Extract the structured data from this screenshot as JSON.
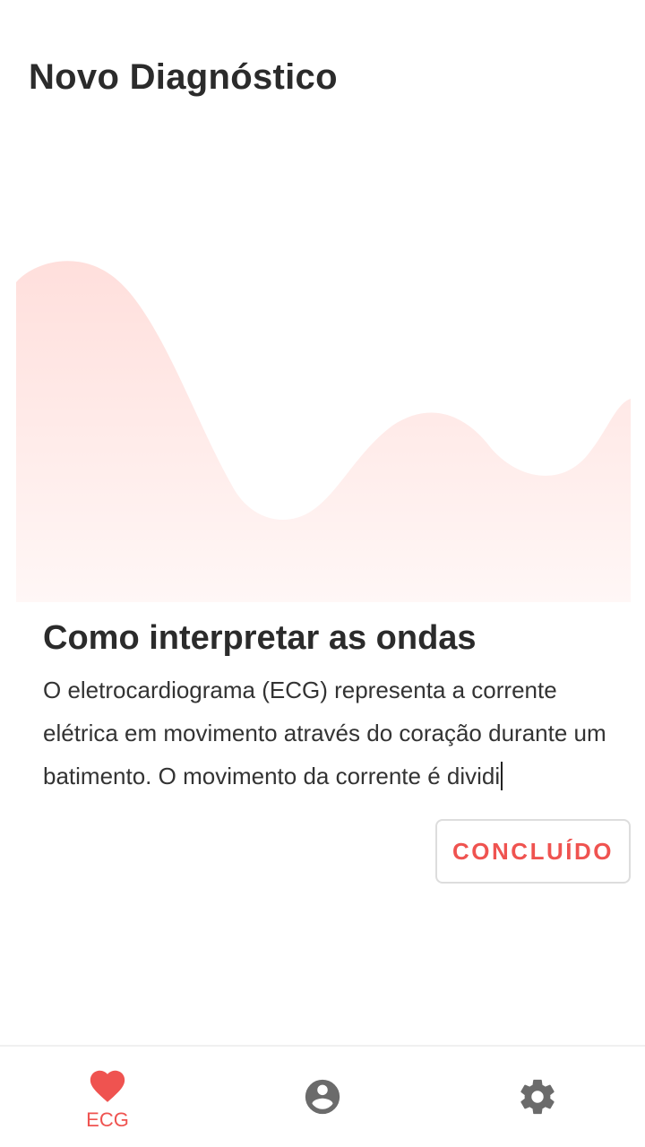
{
  "header": {
    "title": "Novo Diagnóstico"
  },
  "illustration": {
    "icon": "ecg-wave-illustration",
    "color": "#FFE0DE"
  },
  "info": {
    "title": "Como interpretar as ondas",
    "body": "O eletrocardiograma (ECG) representa a corrente elétrica em movimento através do coração durante um batimento. O movimento da corrente é dividi"
  },
  "actions": {
    "done_label": "CONCLUÍDO"
  },
  "bottom_nav": {
    "items": [
      {
        "icon": "heart-icon",
        "label": "ECG",
        "active": true
      },
      {
        "icon": "account-circle-icon",
        "label": "",
        "active": false
      },
      {
        "icon": "settings-gear-icon",
        "label": "",
        "active": false
      }
    ]
  },
  "colors": {
    "accent": "#EF5350",
    "text": "#2B2B2B",
    "icon_inactive": "#6B6B6B"
  }
}
